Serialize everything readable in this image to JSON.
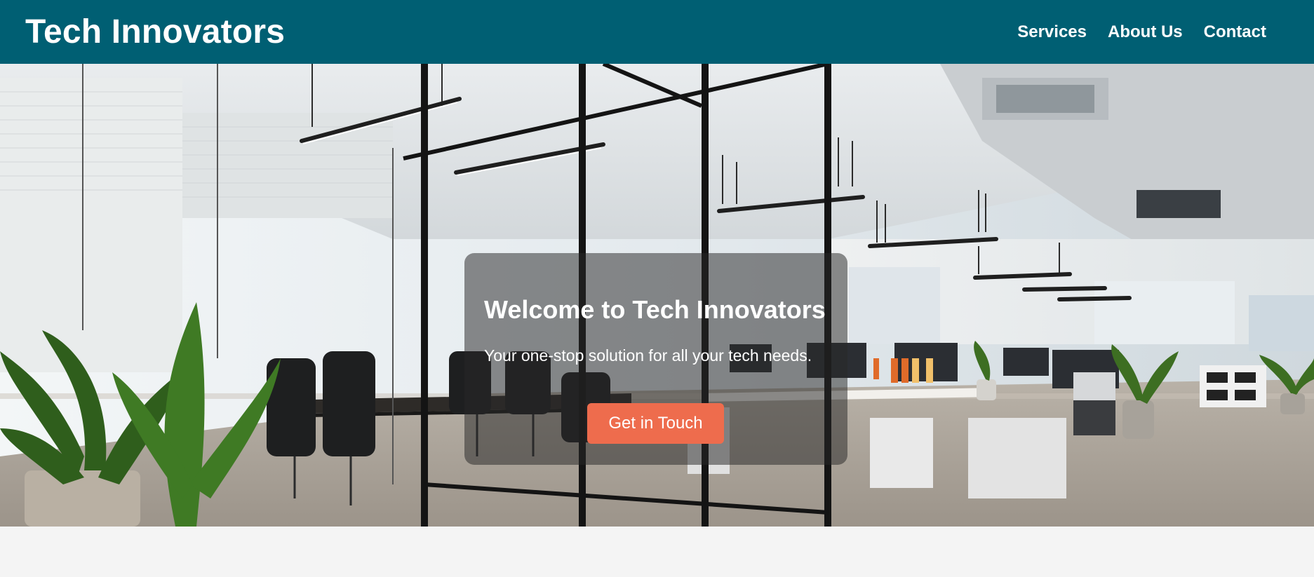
{
  "header": {
    "brand": "Tech Innovators",
    "nav": [
      "Services",
      "About Us",
      "Contact"
    ]
  },
  "hero": {
    "title": "Welcome to Tech Innovators",
    "subtitle": "Your one-stop solution for all your tech needs.",
    "cta_label": "Get in Touch",
    "background_image": "modern-open-plan-office-photo"
  },
  "colors": {
    "header_bg": "#005f73",
    "cta_bg": "#ee6c4d",
    "page_bg": "#f4f4f4",
    "overlay_bg": "rgba(40,40,40,0.52)"
  }
}
